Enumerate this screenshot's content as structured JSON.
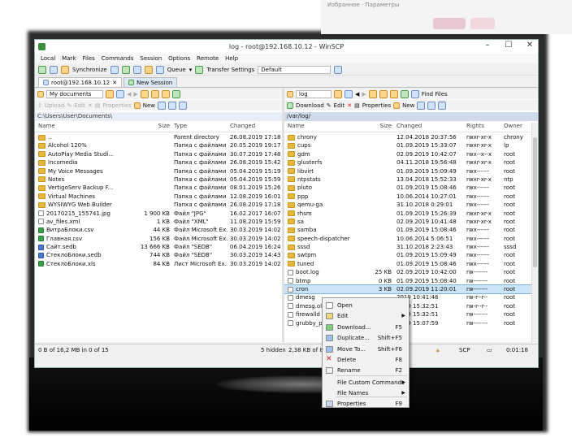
{
  "window": {
    "title": "log - root@192.168.10.12 - WinSCP",
    "bg_text": "Избранное · Параметры"
  },
  "menu": [
    "Local",
    "Mark",
    "Files",
    "Commands",
    "Session",
    "Options",
    "Remote",
    "Help"
  ],
  "toolbar": {
    "synchronize": "Synchronize",
    "queue": "Queue",
    "transfer_settings": "Transfer Settings",
    "transfer_preset": "Default"
  },
  "tabs": [
    {
      "label": "root@192.168.10.12"
    },
    {
      "label": "New Session"
    }
  ],
  "left_pane": {
    "location": "My documents",
    "toolbar": {
      "upload": "Upload",
      "edit": "Edit",
      "properties": "Properties",
      "new": "New"
    },
    "path": "C:\\Users\\User\\Documents\\",
    "columns": {
      "name": "Name",
      "size": "Size",
      "type": "Type",
      "changed": "Changed"
    },
    "files": [
      {
        "name": "..",
        "size": "",
        "type": "Parent directory",
        "changed": "26.08.2019 17:18:00",
        "icon": "folder-up"
      },
      {
        "name": "Alcohol 120%",
        "size": "",
        "type": "Папка с файлами",
        "changed": "20.05.2019 19:17:39",
        "icon": "folder"
      },
      {
        "name": "AutoPlay Media Studi...",
        "size": "",
        "type": "Папка с файлами",
        "changed": "30.07.2019 17:48:01",
        "icon": "folder"
      },
      {
        "name": "Incomedia",
        "size": "",
        "type": "Папка с файлами",
        "changed": "26.08.2019 15:42:01",
        "icon": "folder"
      },
      {
        "name": "My Voice Messages",
        "size": "",
        "type": "Папка с файлами",
        "changed": "05.04.2019 15:19:25",
        "icon": "folder"
      },
      {
        "name": "Notes",
        "size": "",
        "type": "Папка с файлами",
        "changed": "05.04.2019 15:59:56",
        "icon": "folder"
      },
      {
        "name": "VertigoServ Backup F...",
        "size": "",
        "type": "Папка с файлами",
        "changed": "08.01.2019 15:26:50",
        "icon": "folder"
      },
      {
        "name": "Virtual Machines",
        "size": "",
        "type": "Папка с файлами",
        "changed": "12.08.2019 16:01:38",
        "icon": "folder"
      },
      {
        "name": "WYSIWYG Web Builder",
        "size": "",
        "type": "Папка с файлами",
        "changed": "26.08.2019 17:18:00",
        "icon": "folder"
      },
      {
        "name": "20170215_155741.jpg",
        "size": "1 900 KB",
        "type": "Файл \"JPG\"",
        "changed": "16.02.2017 16:07:51",
        "icon": "file"
      },
      {
        "name": "av_files.xml",
        "size": "1 KB",
        "type": "Файл \"XML\"",
        "changed": "11.08.2019 15:59:40",
        "icon": "file"
      },
      {
        "name": "ВитраБлоки.csv",
        "size": "44 KB",
        "type": "Файл Microsoft Ex...",
        "changed": "30.03.2019 14:02:33",
        "icon": "green"
      },
      {
        "name": "Главная.csv",
        "size": "156 KB",
        "type": "Файл Microsoft Ex...",
        "changed": "30.03.2019 14:02:18",
        "icon": "green"
      },
      {
        "name": "Сайт.sedb",
        "size": "13 666 KB",
        "type": "Файл \"SEDB\"",
        "changed": "06.04.2019 16:24:51",
        "icon": "blue"
      },
      {
        "name": "СтеклоБлоки.sedb",
        "size": "744 KB",
        "type": "Файл \"SEDB\"",
        "changed": "30.03.2019 14:43:59",
        "icon": "blue"
      },
      {
        "name": "СтеклоБлоки.xls",
        "size": "84 KB",
        "type": "Лист Microsoft Ex...",
        "changed": "30.03.2019 14:02:56",
        "icon": "green"
      }
    ]
  },
  "right_pane": {
    "location": "log",
    "find_files": "Find Files",
    "toolbar": {
      "download": "Download",
      "edit": "Edit",
      "properties": "Properties",
      "new": "New"
    },
    "path": "/var/log/",
    "columns": {
      "name": "Name",
      "size": "Size",
      "changed": "Changed",
      "rights": "Rights",
      "owner": "Owner"
    },
    "files": [
      {
        "name": "chrony",
        "size": "",
        "changed": "12.04.2018 20:37:56",
        "rights": "rwxr-xr-x",
        "owner": "chrony",
        "icon": "folder"
      },
      {
        "name": "cups",
        "size": "",
        "changed": "01.09.2019 15:33:07",
        "rights": "rwxr-xr-x",
        "owner": "lp",
        "icon": "folder"
      },
      {
        "name": "gdm",
        "size": "",
        "changed": "02.09.2019 10:42:07",
        "rights": "rwx--x--x",
        "owner": "root",
        "icon": "folder"
      },
      {
        "name": "glusterfs",
        "size": "",
        "changed": "04.11.2018 19:56:48",
        "rights": "rwxr-xr-x",
        "owner": "root",
        "icon": "folder"
      },
      {
        "name": "libvirt",
        "size": "",
        "changed": "01.09.2019 15:09:49",
        "rights": "rwx------",
        "owner": "root",
        "icon": "folder"
      },
      {
        "name": "ntpstats",
        "size": "",
        "changed": "13.04.2018 15:52:33",
        "rights": "rwxr-xr-x",
        "owner": "ntp",
        "icon": "folder"
      },
      {
        "name": "pluto",
        "size": "",
        "changed": "01.09.2019 15:08:46",
        "rights": "rwx------",
        "owner": "root",
        "icon": "folder"
      },
      {
        "name": "ppp",
        "size": "",
        "changed": "10.06.2014 10:27:01",
        "rights": "rwx------",
        "owner": "root",
        "icon": "folder"
      },
      {
        "name": "qemu-ga",
        "size": "",
        "changed": "31.10.2018 0:29:01",
        "rights": "rwx------",
        "owner": "root",
        "icon": "folder"
      },
      {
        "name": "rhsm",
        "size": "",
        "changed": "01.09.2019 15:26:39",
        "rights": "rwxr-xr-x",
        "owner": "root",
        "icon": "folder"
      },
      {
        "name": "sa",
        "size": "",
        "changed": "02.09.2019 10:41:48",
        "rights": "rwxr-xr-x",
        "owner": "root",
        "icon": "folder"
      },
      {
        "name": "samba",
        "size": "",
        "changed": "01.09.2019 15:08:46",
        "rights": "rwx------",
        "owner": "root",
        "icon": "folder"
      },
      {
        "name": "speech-dispatcher",
        "size": "",
        "changed": "10.06.2014 5:06:51",
        "rights": "rwx------",
        "owner": "root",
        "icon": "folder"
      },
      {
        "name": "sssd",
        "size": "",
        "changed": "31.10.2018 2:23:43",
        "rights": "rwx------",
        "owner": "sssd",
        "icon": "folder"
      },
      {
        "name": "swtpm",
        "size": "",
        "changed": "01.09.2019 15:09:49",
        "rights": "rwx------",
        "owner": "root",
        "icon": "folder"
      },
      {
        "name": "tuned",
        "size": "",
        "changed": "01.09.2019 15:08:46",
        "rights": "rwx------",
        "owner": "root",
        "icon": "folder"
      },
      {
        "name": "boot.log",
        "size": "25 KB",
        "changed": "02.09.2019 10:42:00",
        "rights": "rw-------",
        "owner": "root",
        "icon": "file"
      },
      {
        "name": "btmp",
        "size": "0 KB",
        "changed": "01.09.2019 15:08:40",
        "rights": "rw-------",
        "owner": "root",
        "icon": "file"
      },
      {
        "name": "cron",
        "size": "3 KB",
        "changed": "02.09.2019 11:20:01",
        "rights": "rw-------",
        "owner": "root",
        "icon": "file",
        "selected": true
      },
      {
        "name": "dmesg",
        "size": "",
        "changed": "2019 10:41:48",
        "rights": "rw-r--r--",
        "owner": "root",
        "icon": "file"
      },
      {
        "name": "dmesg.old",
        "size": "",
        "changed": "2019 15:32:51",
        "rights": "rw-r--r--",
        "owner": "root",
        "icon": "file"
      },
      {
        "name": "firewalld",
        "size": "",
        "changed": "2019 15:32:51",
        "rights": "rw-------",
        "owner": "root",
        "icon": "file"
      },
      {
        "name": "grubby_pr...",
        "size": "",
        "changed": "2019 15:07:59",
        "rights": "rw-------",
        "owner": "root",
        "icon": "file"
      }
    ]
  },
  "status": {
    "left": "0 B of 16,2 MB in 0 of 15",
    "hidden": "5 hidden",
    "right": "2,38 KB of 846",
    "protocol": "SCP",
    "time": "0:01:18"
  },
  "context_menu": [
    {
      "label": "Open",
      "shortcut": "",
      "icon": "open"
    },
    {
      "label": "Edit",
      "shortcut": "",
      "submenu": true,
      "icon": "edit"
    },
    {
      "label": "Download...",
      "shortcut": "F5",
      "submenu": true,
      "icon": "download"
    },
    {
      "label": "Duplicate...",
      "shortcut": "Shift+F5",
      "icon": "duplicate"
    },
    {
      "label": "Move To...",
      "shortcut": "Shift+F6",
      "icon": "move"
    },
    {
      "label": "Delete",
      "shortcut": "F8",
      "icon": "delete"
    },
    {
      "label": "Rename",
      "shortcut": "F2",
      "icon": "rename"
    },
    {
      "label": "File Custom Commands",
      "shortcut": "",
      "submenu": true,
      "icon": ""
    },
    {
      "label": "File Names",
      "shortcut": "",
      "submenu": true,
      "icon": ""
    },
    {
      "label": "Properties",
      "shortcut": "F9",
      "icon": "properties"
    }
  ]
}
